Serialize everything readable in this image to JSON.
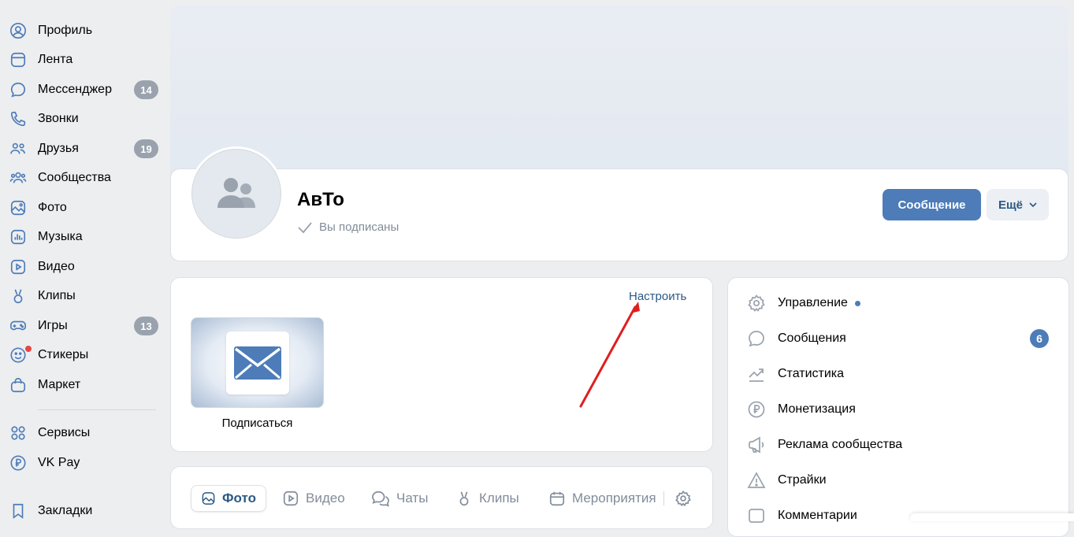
{
  "sidebar": {
    "items": [
      {
        "label": "Профиль",
        "icon": "user-circle-icon"
      },
      {
        "label": "Лента",
        "icon": "feed-icon"
      },
      {
        "label": "Мессенджер",
        "icon": "message-icon",
        "badge": "14"
      },
      {
        "label": "Звонки",
        "icon": "phone-icon"
      },
      {
        "label": "Друзья",
        "icon": "friends-icon",
        "badge": "19"
      },
      {
        "label": "Сообщества",
        "icon": "communities-icon"
      },
      {
        "label": "Фото",
        "icon": "photo-icon"
      },
      {
        "label": "Музыка",
        "icon": "music-icon"
      },
      {
        "label": "Видео",
        "icon": "video-icon"
      },
      {
        "label": "Клипы",
        "icon": "clips-icon"
      },
      {
        "label": "Игры",
        "icon": "gamepad-icon",
        "badge": "13"
      },
      {
        "label": "Стикеры",
        "icon": "smile-icon"
      },
      {
        "label": "Маркет",
        "icon": "market-bag-icon"
      },
      {
        "label": "Сервисы",
        "icon": "services-grid-icon"
      },
      {
        "label": "VK Pay",
        "icon": "ruble-circle-icon"
      },
      {
        "label": "Закладки",
        "icon": "bookmark-icon"
      }
    ]
  },
  "header": {
    "title": "АвТо",
    "subscribed_label": "Вы подписаны",
    "message_button": "Сообщение",
    "more_button": "Ещё"
  },
  "widgets": {
    "configure_link": "Настроить",
    "subscribe_label": "Подписаться"
  },
  "tabs": [
    {
      "label": "Фото",
      "icon": "photo-icon",
      "active": true
    },
    {
      "label": "Видео",
      "icon": "video-icon"
    },
    {
      "label": "Чаты",
      "icon": "chats-icon"
    },
    {
      "label": "Клипы",
      "icon": "clips-icon"
    },
    {
      "label": "Мероприятия",
      "icon": "calendar-icon"
    }
  ],
  "management": {
    "items": [
      {
        "label": "Управление",
        "icon": "gear-icon"
      },
      {
        "label": "Сообщения",
        "icon": "message-icon",
        "badge": "6"
      },
      {
        "label": "Статистика",
        "icon": "chart-trend-icon"
      },
      {
        "label": "Монетизация",
        "icon": "ruble-circle-icon"
      },
      {
        "label": "Реклама сообщества",
        "icon": "megaphone-icon"
      },
      {
        "label": "Страйки",
        "icon": "warning-icon"
      },
      {
        "label": "Комментарии",
        "icon": "comment-box-icon"
      }
    ]
  },
  "colors": {
    "accent": "#4d7cb8",
    "link": "#2a5885",
    "annotation_arrow": "#e01e1e",
    "badge_grey": "#99a2ad"
  }
}
